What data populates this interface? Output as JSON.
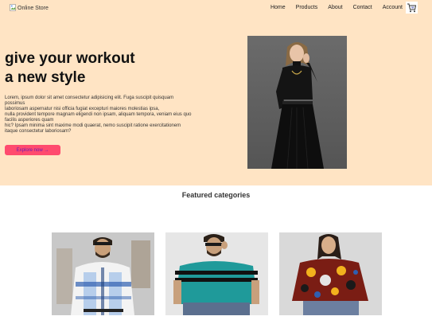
{
  "nav": {
    "logo_alt": "Online Store",
    "links": [
      "Home",
      "Products",
      "About",
      "Contact",
      "Account"
    ]
  },
  "hero": {
    "title_line1": "give your workout",
    "title_line2": "a new style",
    "text_lines": [
      "Lorem, ipsum dolor sit amet consectetur adipisicing elit. Fuga suscipit quisquam",
      "possimus",
      "laboriosam aspernatur nisi officia fugiat excepturi maiores molestias ipsa,",
      "nulla provident tempore magnam eligendi non ipsam, aliquam tempora, veniam eius quo",
      "facilis asperiores quam",
      "hic? Ipsam minima sint maxime modi quaerat, nemo suscipit ratione exercitationem",
      "itaque consectetur laboriosam?"
    ],
    "cta_label": "Explore now →"
  },
  "featured": {
    "title": "Featured categories"
  },
  "colors": {
    "hero_bg": "#ffe4c4",
    "cta_bg": "#ff4a6e",
    "cta_text": "#6b1ab0"
  }
}
